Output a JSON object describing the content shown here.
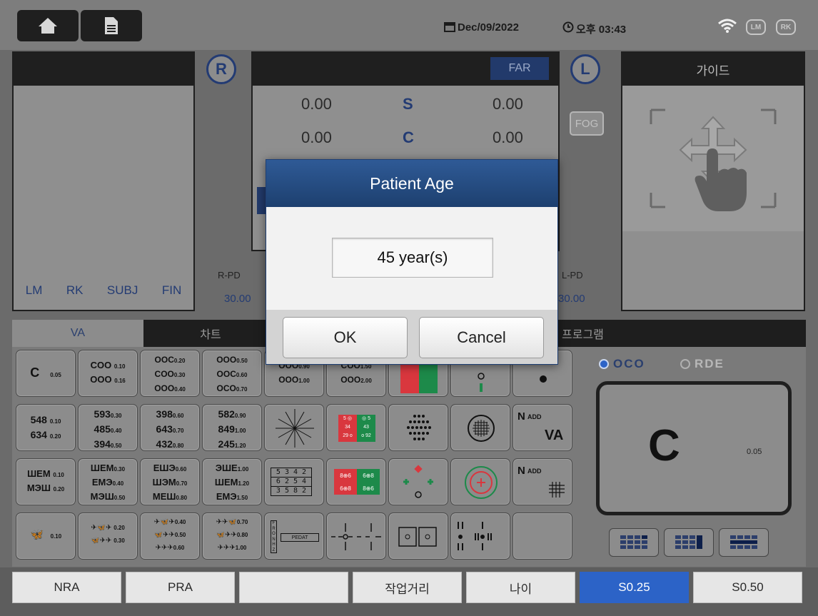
{
  "header": {
    "date": "Dec/09/2022",
    "time": "오후 03:43",
    "badges": [
      "LM",
      "RK"
    ]
  },
  "left_panel": {
    "tabs": [
      "LM",
      "RK",
      "SUBJ",
      "FIN"
    ]
  },
  "eyes": {
    "right": "R",
    "left": "L"
  },
  "center_panel": {
    "mode": "FAR",
    "rows": [
      {
        "label": "S",
        "right": "0.00",
        "left": "0.00"
      },
      {
        "label": "C",
        "right": "0.00",
        "left": "0.00"
      }
    ]
  },
  "fog_label": "FOG",
  "pd": {
    "right_label": "R-PD",
    "right_value": "30.00",
    "left_label": "L-PD",
    "left_value": "30.00"
  },
  "guide": {
    "title": "가이드"
  },
  "tabs": [
    "VA",
    "차트",
    "프로그램"
  ],
  "charts": {
    "c1": {
      "rows": [
        {
          "t": "C",
          "n": "0.05"
        }
      ]
    },
    "c2": {
      "rows": [
        {
          "t": "COO",
          "n": "0.10"
        },
        {
          "t": "OOO",
          "n": "0.16"
        }
      ]
    },
    "c3": {
      "rows": [
        {
          "t": "OOC",
          "n": "0.20"
        },
        {
          "t": "COO",
          "n": "0.30"
        },
        {
          "t": "OOO",
          "n": "0.40"
        }
      ]
    },
    "c4": {
      "rows": [
        {
          "t": "OOO",
          "n": "0.50"
        },
        {
          "t": "OOC",
          "n": "0.60"
        },
        {
          "t": "OCO",
          "n": "0.70"
        }
      ]
    },
    "c5": {
      "rows": [
        {
          "t": "OOO",
          "n": "0.90"
        },
        {
          "t": "OOO",
          "n": "1.00"
        }
      ]
    },
    "c6": {
      "rows": [
        {
          "t": "COO",
          "n": "1.50"
        },
        {
          "t": "OOO",
          "n": "2.00"
        }
      ]
    },
    "n1": {
      "rows": [
        {
          "t": "548",
          "n": "0.10"
        },
        {
          "t": "634",
          "n": "0.20"
        }
      ]
    },
    "n2": {
      "rows": [
        {
          "t": "593",
          "n": "0.30"
        },
        {
          "t": "485",
          "n": "0.40"
        },
        {
          "t": "394",
          "n": "0.50"
        }
      ]
    },
    "n3": {
      "rows": [
        {
          "t": "398",
          "n": "0.60"
        },
        {
          "t": "643",
          "n": "0.70"
        },
        {
          "t": "432",
          "n": "0.80"
        }
      ]
    },
    "n4": {
      "rows": [
        {
          "t": "582",
          "n": "0.90"
        },
        {
          "t": "849",
          "n": "1.00"
        },
        {
          "t": "245",
          "n": "1.20"
        }
      ]
    },
    "e1": {
      "rows": [
        {
          "t": "ШЕМ",
          "n": "0.10"
        },
        {
          "t": "МЭШ",
          "n": "0.20"
        }
      ]
    },
    "e2": {
      "rows": [
        {
          "t": "ШЕМ",
          "n": "0.30"
        },
        {
          "t": "ЕМЭ",
          "n": "0.40"
        },
        {
          "t": "МЭШ",
          "n": "0.50"
        }
      ]
    },
    "e3": {
      "rows": [
        {
          "t": "ЕШЭ",
          "n": "0.60"
        },
        {
          "t": "ШЭМ",
          "n": "0.70"
        },
        {
          "t": "МЕШ",
          "n": "0.80"
        }
      ]
    },
    "e4": {
      "rows": [
        {
          "t": "ЭШЕ",
          "n": "1.00"
        },
        {
          "t": "ШЕМ",
          "n": "1.20"
        },
        {
          "t": "ЕМЭ",
          "n": "1.50"
        }
      ]
    },
    "b1": {
      "rows": [
        {
          "t": "🦋",
          "n": "0.10"
        }
      ]
    },
    "b2": {
      "rows": [
        {
          "t": "✈🦋✈",
          "n": "0.20"
        },
        {
          "t": "🦋✈✈",
          "n": "0.30"
        }
      ]
    },
    "b3": {
      "rows": [
        {
          "t": "✈🦋✈",
          "n": "0.40"
        },
        {
          "t": "🦋✈✈",
          "n": "0.50"
        },
        {
          "t": "✈✈✈",
          "n": "0.60"
        }
      ]
    },
    "b4": {
      "rows": [
        {
          "t": "✈✈🦋",
          "n": "0.70"
        },
        {
          "t": "🦋✈✈",
          "n": "0.80"
        },
        {
          "t": "✈✈✈",
          "n": "1.00"
        }
      ]
    },
    "rg": {
      "a": "5 ◎",
      "b": "◎ 5",
      "c": "34",
      "d": "43",
      "e": "29 o",
      "f": "o 92"
    },
    "sq": {
      "r1": "5 3 4 2",
      "r2": "6 2 5 4",
      "r3": "3 5 8 2"
    },
    "rg2": {
      "a": "8⊕6",
      "b": "6⊕8",
      "c": "6⊕8",
      "d": "8⊕6"
    },
    "pedat": {
      "vert": "FRONHZ",
      "h": "PEDAT"
    },
    "nadd": {
      "n": "N",
      "add": "ADD",
      "va": "VA"
    }
  },
  "program": {
    "options": [
      {
        "label": "OCO",
        "selected": true
      },
      {
        "label": "RDE",
        "selected": false
      }
    ],
    "preview_symbol": "C",
    "preview_value": "0.05"
  },
  "bottom": {
    "buttons": [
      {
        "label": "NRA",
        "active": false
      },
      {
        "label": "PRA",
        "active": false
      },
      {
        "label": "",
        "active": false
      },
      {
        "label": "작업거리",
        "active": false
      },
      {
        "label": "나이",
        "active": false
      },
      {
        "label": "S0.25",
        "active": true
      },
      {
        "label": "S0.50",
        "active": false
      }
    ]
  },
  "modal": {
    "title": "Patient Age",
    "value": "45 year(s)",
    "ok": "OK",
    "cancel": "Cancel"
  }
}
